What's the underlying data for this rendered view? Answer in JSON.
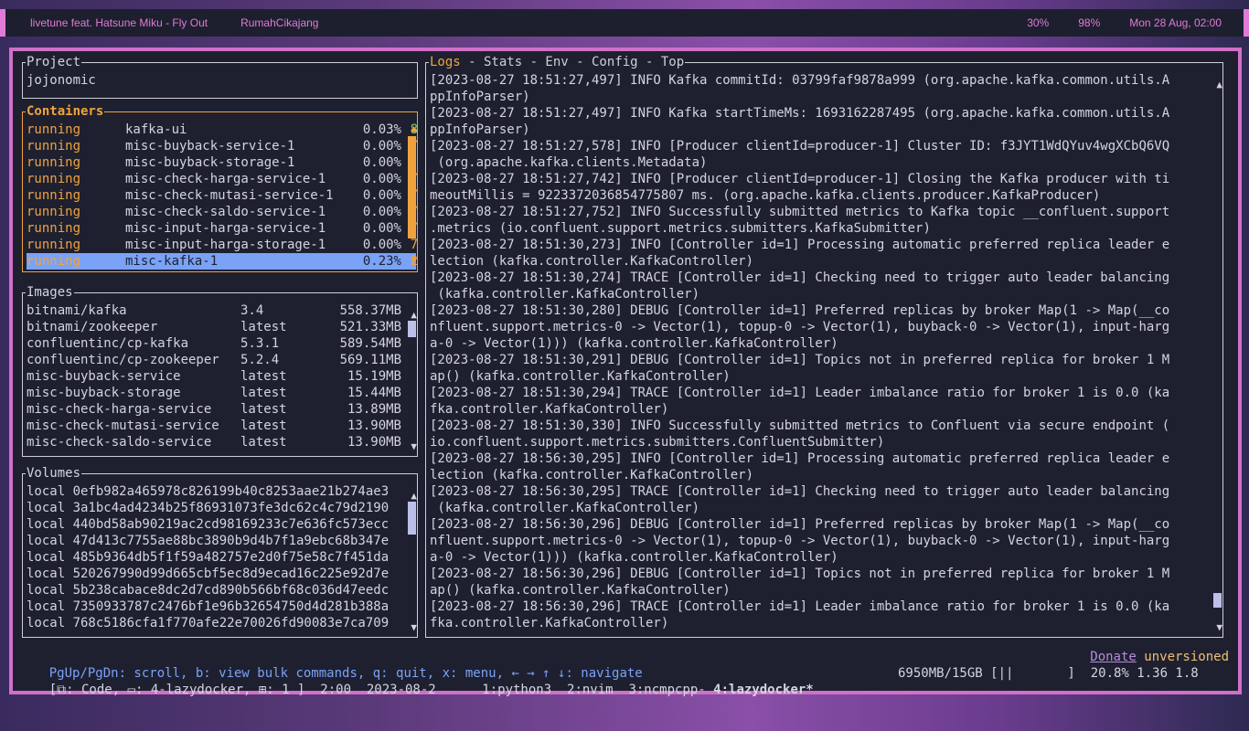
{
  "topbar": {
    "song": "livetune feat. Hatsune Miku - Fly Out",
    "host": "RumahCikajang",
    "volume": "30%",
    "battery": "98%",
    "datetime": "Mon 28 Aug, 02:00"
  },
  "project": {
    "title": "Project",
    "name": "jojonomic"
  },
  "containers": {
    "title": "Containers",
    "items": [
      {
        "status": "running",
        "name": "kafka-ui",
        "cpu": "0.03%",
        "num": "8"
      },
      {
        "status": "running",
        "name": "misc-buyback-service-1",
        "cpu": "0.00%",
        "num": "7"
      },
      {
        "status": "running",
        "name": "misc-buyback-storage-1",
        "cpu": "0.00%",
        "num": ""
      },
      {
        "status": "running",
        "name": "misc-check-harga-service-1",
        "cpu": "0.00%",
        "num": "7"
      },
      {
        "status": "running",
        "name": "misc-check-mutasi-service-1",
        "cpu": "0.00%",
        "num": "7"
      },
      {
        "status": "running",
        "name": "misc-check-saldo-service-1",
        "cpu": "0.00%",
        "num": "7"
      },
      {
        "status": "running",
        "name": "misc-input-harga-service-1",
        "cpu": "0.00%",
        "num": "7"
      },
      {
        "status": "running",
        "name": "misc-input-harga-storage-1",
        "cpu": "0.00%",
        "num": "7"
      },
      {
        "status": "running",
        "name": "misc-kafka-1",
        "cpu": "0.23%",
        "num": "2"
      }
    ]
  },
  "images": {
    "title": "Images",
    "items": [
      {
        "name": "bitnami/kafka",
        "tag": "3.4",
        "size": "558.37MB"
      },
      {
        "name": "bitnami/zookeeper",
        "tag": "latest",
        "size": "521.33MB"
      },
      {
        "name": "confluentinc/cp-kafka",
        "tag": "5.3.1",
        "size": "589.54MB"
      },
      {
        "name": "confluentinc/cp-zookeeper",
        "tag": "5.2.4",
        "size": "569.11MB"
      },
      {
        "name": "misc-buyback-service",
        "tag": "latest",
        "size": "15.19MB"
      },
      {
        "name": "misc-buyback-storage",
        "tag": "latest",
        "size": "15.44MB"
      },
      {
        "name": "misc-check-harga-service",
        "tag": "latest",
        "size": "13.89MB"
      },
      {
        "name": "misc-check-mutasi-service",
        "tag": "latest",
        "size": "13.90MB"
      },
      {
        "name": "misc-check-saldo-service",
        "tag": "latest",
        "size": "13.90MB"
      }
    ]
  },
  "volumes": {
    "title": "Volumes",
    "items": [
      "local 0efb982a465978c826199b40c8253aae21b274ae3",
      "local 3a1bc4ad4234b25f86931073fe3dc62c4c79d2190",
      "local 440bd58ab90219ac2cd98169233c7e636fc573ecc",
      "local 47d413c7755ae88bc3890b9d4b7f1a9ebc68b347e",
      "local 485b9364db5f1f59a482757e2d0f75e58c7f451da",
      "local 520267990d99d665cbf5ec8d9ecad16c225e92d7e",
      "local 5b238cabace8dc2d7cd890b566bf68c036d47eedc",
      "local 7350933787c2476bf1e96b32654750d4d281b388a",
      "local 768c5186cfa1f770afe22e70026fd90083e7ca709"
    ]
  },
  "logs": {
    "tabs": {
      "active": "Logs",
      "rest": " - Stats - Env - Config - Top"
    },
    "lines": [
      "[2023-08-27 18:51:27,497] INFO Kafka commitId: 03799faf9878a999 (org.apache.kafka.common.utils.A",
      "ppInfoParser)",
      "[2023-08-27 18:51:27,497] INFO Kafka startTimeMs: 1693162287495 (org.apache.kafka.common.utils.A",
      "ppInfoParser)",
      "[2023-08-27 18:51:27,578] INFO [Producer clientId=producer-1] Cluster ID: f3JYT1WdQYuv4wgXCbQ6VQ",
      " (org.apache.kafka.clients.Metadata)",
      "[2023-08-27 18:51:27,742] INFO [Producer clientId=producer-1] Closing the Kafka producer with ti",
      "meoutMillis = 9223372036854775807 ms. (org.apache.kafka.clients.producer.KafkaProducer)",
      "[2023-08-27 18:51:27,752] INFO Successfully submitted metrics to Kafka topic __confluent.support",
      ".metrics (io.confluent.support.metrics.submitters.KafkaSubmitter)",
      "[2023-08-27 18:51:30,273] INFO [Controller id=1] Processing automatic preferred replica leader e",
      "lection (kafka.controller.KafkaController)",
      "[2023-08-27 18:51:30,274] TRACE [Controller id=1] Checking need to trigger auto leader balancing",
      " (kafka.controller.KafkaController)",
      "[2023-08-27 18:51:30,280] DEBUG [Controller id=1] Preferred replicas by broker Map(1 -> Map(__co",
      "nfluent.support.metrics-0 -> Vector(1), topup-0 -> Vector(1), buyback-0 -> Vector(1), input-harg",
      "a-0 -> Vector(1))) (kafka.controller.KafkaController)",
      "[2023-08-27 18:51:30,291] DEBUG [Controller id=1] Topics not in preferred replica for broker 1 M",
      "ap() (kafka.controller.KafkaController)",
      "[2023-08-27 18:51:30,294] TRACE [Controller id=1] Leader imbalance ratio for broker 1 is 0.0 (ka",
      "fka.controller.KafkaController)",
      "[2023-08-27 18:51:30,330] INFO Successfully submitted metrics to Confluent via secure endpoint (",
      "io.confluent.support.metrics.submitters.ConfluentSubmitter)",
      "[2023-08-27 18:56:30,295] INFO [Controller id=1] Processing automatic preferred replica leader e",
      "lection (kafka.controller.KafkaController)",
      "[2023-08-27 18:56:30,295] TRACE [Controller id=1] Checking need to trigger auto leader balancing",
      " (kafka.controller.KafkaController)",
      "[2023-08-27 18:56:30,296] DEBUG [Controller id=1] Preferred replicas by broker Map(1 -> Map(__co",
      "nfluent.support.metrics-0 -> Vector(1), topup-0 -> Vector(1), buyback-0 -> Vector(1), input-harg",
      "a-0 -> Vector(1))) (kafka.controller.KafkaController)",
      "[2023-08-27 18:56:30,296] DEBUG [Controller id=1] Topics not in preferred replica for broker 1 M",
      "ap() (kafka.controller.KafkaController)",
      "[2023-08-27 18:56:30,296] TRACE [Controller id=1] Leader imbalance ratio for broker 1 is 0.0 (ka",
      "fka.controller.KafkaController)"
    ]
  },
  "footer": {
    "keys": "PgUp/PgDn: scroll, b: view bulk commands, q: quit, x: menu, ← → ↑ ↓: navigate",
    "donate": "Donate",
    "version": "unversioned",
    "tmux_left": "[⧉: Code, ▭: 4-lazydocker, ⊞: 1 ]  2:00  2023-08-2      1:python3  2:nvim  3:ncmpcpp- ",
    "tmux_active": "4:lazydocker*",
    "tmux_right": "6950MB/15GB [||       ]  20.8% 1.36 1.8"
  }
}
